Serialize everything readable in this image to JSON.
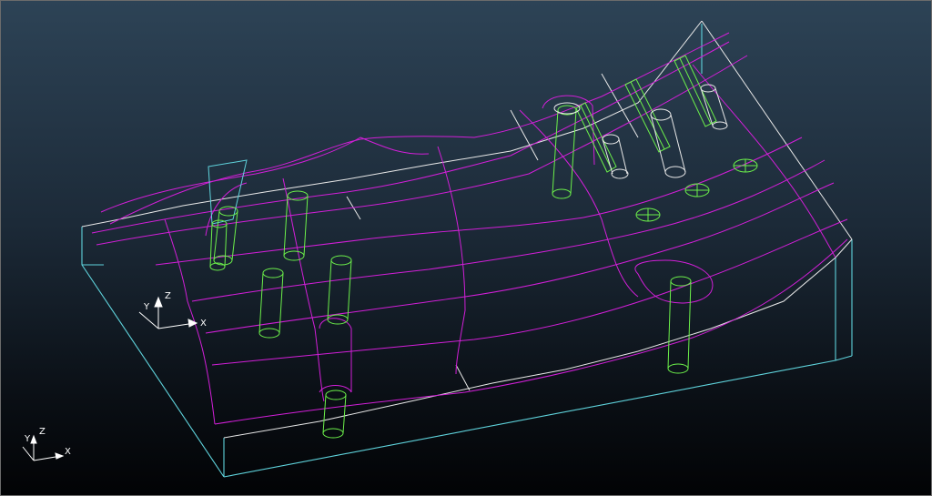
{
  "viewport": {
    "model_triad": {
      "x_label": "X",
      "y_label": "Y",
      "z_label": "Z"
    },
    "corner_triad": {
      "x_label": "X",
      "y_label": "Y",
      "z_label": "Z"
    }
  },
  "colors": {
    "background_top": "#2d4356",
    "background_bottom": "#020305",
    "edge_cyan": "#5fd3dc",
    "edge_white": "#e8e8e8",
    "edge_magenta": "#d21fd8",
    "pin_green": "#6cf04a"
  }
}
